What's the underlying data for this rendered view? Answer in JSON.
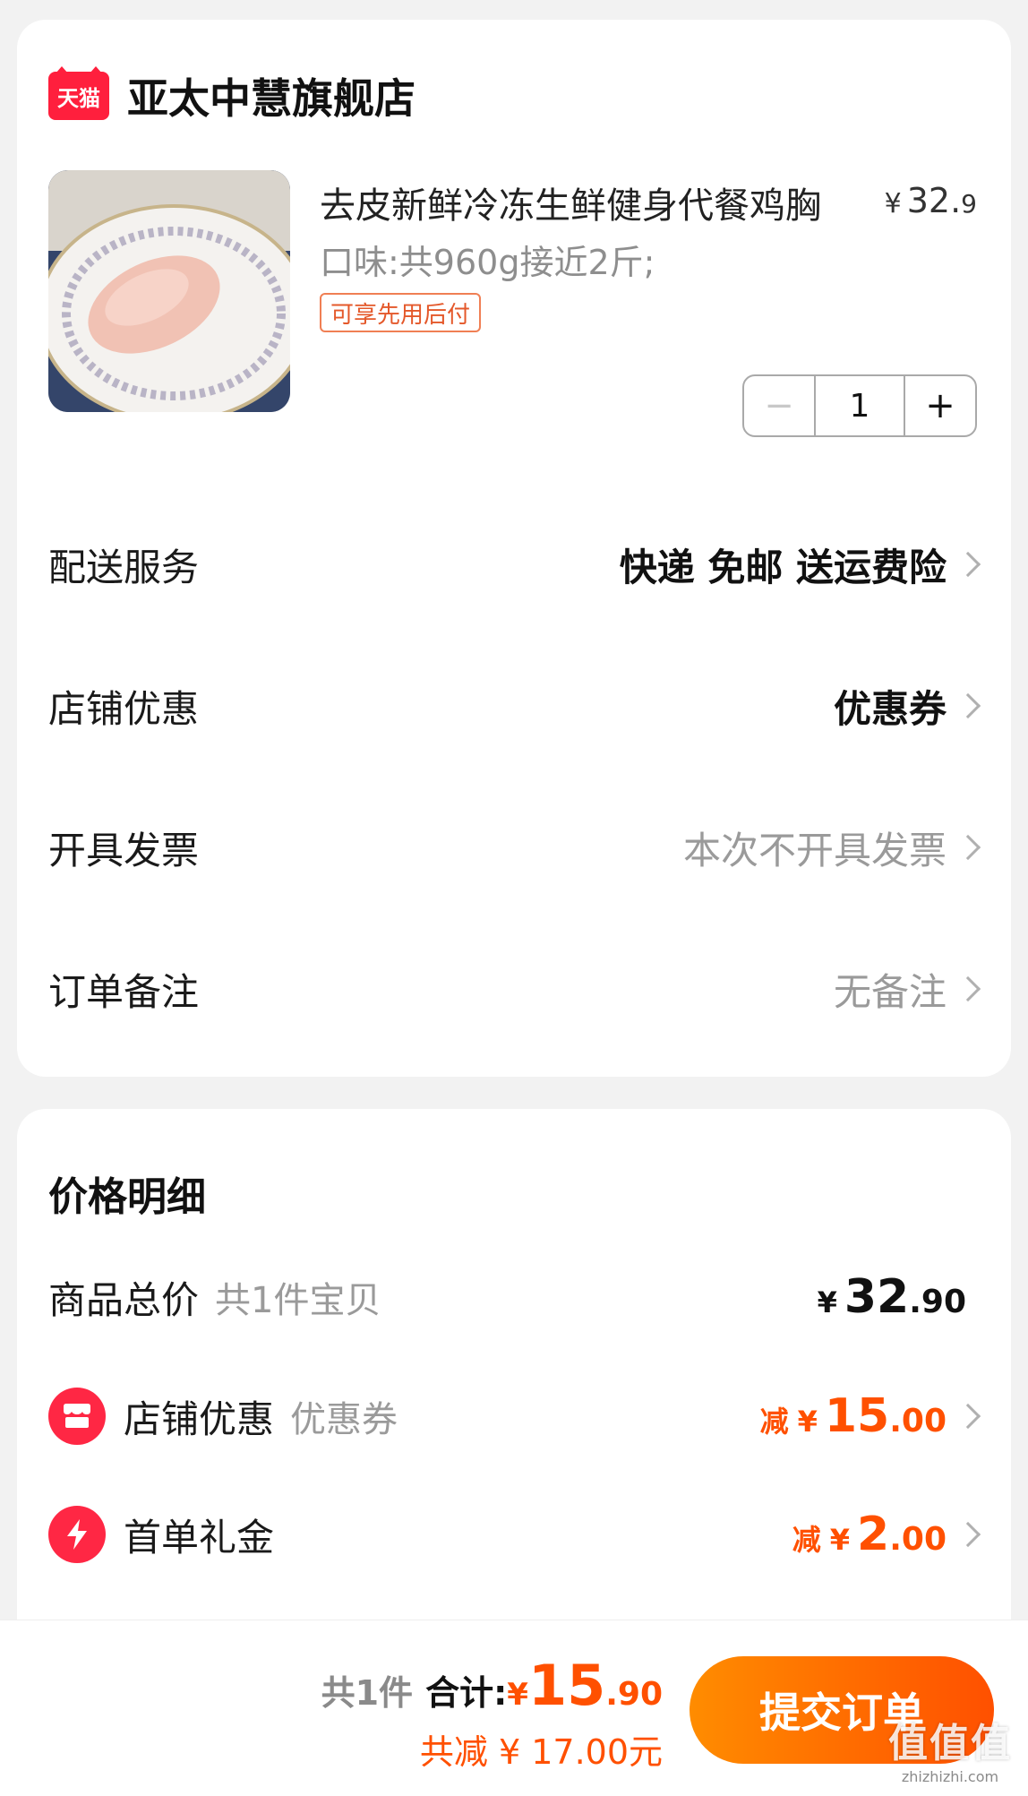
{
  "shop": {
    "badge": "天猫",
    "name": "亚太中慧旗舰店"
  },
  "product": {
    "title": "去皮新鲜冷冻生鲜健身代餐鸡胸",
    "price_currency": "¥",
    "price_int": "32.",
    "price_dec": "9",
    "spec": "口味:共960g接近2斤;",
    "tag": "可享先用后付",
    "quantity": "1",
    "qty_minus": "−",
    "qty_plus": "+"
  },
  "rows": {
    "delivery": {
      "label": "配送服务",
      "value": "快递 免邮 送运费险"
    },
    "shop_discount": {
      "label": "店铺优惠",
      "value": "优惠券"
    },
    "invoice": {
      "label": "开具发票",
      "value": "本次不开具发票"
    },
    "note": {
      "label": "订单备注",
      "value": "无备注"
    }
  },
  "price_detail": {
    "title": "价格明细",
    "goods_total": {
      "label": "商品总价",
      "sub": "共1件宝贝",
      "currency": "¥",
      "int": "32",
      "dec": ".90"
    },
    "shop_discount": {
      "label": "店铺优惠",
      "sub": "优惠券",
      "prefix": "减",
      "currency": "¥",
      "int": "15",
      "dec": ".00",
      "icon": "shop-icon"
    },
    "first_order": {
      "label": "首单礼金",
      "prefix": "减",
      "currency": "¥",
      "int": "2",
      "dec": ".00",
      "icon": "lightning-icon"
    }
  },
  "footer": {
    "count": "共1件",
    "total_label": "合计:",
    "currency": "¥",
    "total_int": "15",
    "total_dec": ".90",
    "saved": "共减 ¥ 17.00元",
    "submit": "提交订单",
    "watermark_big": "值值值",
    "watermark_small": "zhizhizhi.com"
  },
  "colors": {
    "accent": "#ff5000",
    "tmall_red": "#ff1f3d",
    "icon_red": "#ff2744"
  }
}
